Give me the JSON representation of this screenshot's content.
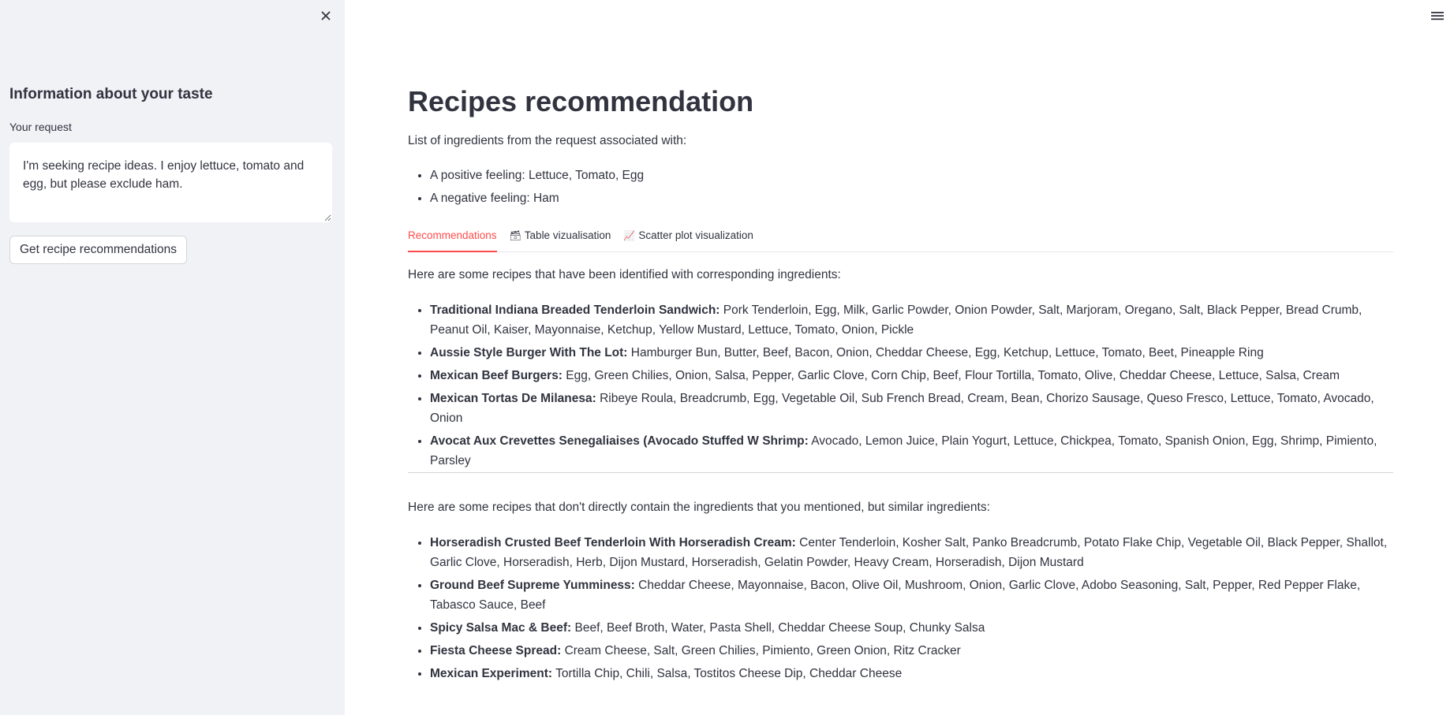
{
  "sidebar": {
    "close_icon": "close-icon",
    "title": "Information about your taste",
    "request_label": "Your request",
    "request_value": "I'm seeking recipe ideas. I enjoy lettuce, tomato and egg, but please exclude ham.",
    "submit_label": "Get recipe recommendations"
  },
  "header": {
    "menu_icon": "hamburger-menu-icon"
  },
  "main": {
    "title": "Recipes recommendation",
    "intro": "List of ingredients from the request associated with:",
    "feelings": [
      "A positive feeling: Lettuce, Tomato, Egg",
      "A negative feeling: Ham"
    ],
    "tabs": [
      {
        "label": "Recommendations",
        "icon": ""
      },
      {
        "label": "Table vizualisation",
        "icon": "🗃"
      },
      {
        "label": "Scatter plot visualization",
        "icon": "📈"
      }
    ],
    "section1_text": "Here are some recipes that have been identified with corresponding ingredients:",
    "recipes1": [
      {
        "name": "Traditional Indiana Breaded Tenderloin Sandwich:",
        "ingredients": "Pork Tenderloin, Egg, Milk, Garlic Powder, Onion Powder, Salt, Marjoram, Oregano, Salt, Black Pepper, Bread Crumb, Peanut Oil, Kaiser, Mayonnaise, Ketchup, Yellow Mustard, Lettuce, Tomato, Onion, Pickle"
      },
      {
        "name": "Aussie Style Burger With The Lot:",
        "ingredients": "Hamburger Bun, Butter, Beef, Bacon, Onion, Cheddar Cheese, Egg, Ketchup, Lettuce, Tomato, Beet, Pineapple Ring"
      },
      {
        "name": "Mexican Beef Burgers:",
        "ingredients": "Egg, Green Chilies, Onion, Salsa, Pepper, Garlic Clove, Corn Chip, Beef, Flour Tortilla, Tomato, Olive, Cheddar Cheese, Lettuce, Salsa, Cream"
      },
      {
        "name": "Mexican Tortas De Milanesa:",
        "ingredients": "Ribeye Roula, Breadcrumb, Egg, Vegetable Oil, Sub French Bread, Cream, Bean, Chorizo Sausage, Queso Fresco, Lettuce, Tomato, Avocado, Onion"
      },
      {
        "name": "Avocat Aux Crevettes Senegaliaises (Avocado Stuffed W Shrimp:",
        "ingredients": "Avocado, Lemon Juice, Plain Yogurt, Lettuce, Chickpea, Tomato, Spanish Onion, Egg, Shrimp, Pimiento, Parsley"
      }
    ],
    "section2_text": "Here are some recipes that don't directly contain the ingredients that you mentioned, but similar ingredients:",
    "recipes2": [
      {
        "name": "Horseradish Crusted Beef Tenderloin With Horseradish Cream:",
        "ingredients": "Center Tenderloin, Kosher Salt, Panko Breadcrumb, Potato Flake Chip, Vegetable Oil, Black Pepper, Shallot, Garlic Clove, Horseradish, Herb, Dijon Mustard, Horseradish, Gelatin Powder, Heavy Cream, Horseradish, Dijon Mustard"
      },
      {
        "name": "Ground Beef Supreme Yumminess:",
        "ingredients": "Cheddar Cheese, Mayonnaise, Bacon, Olive Oil, Mushroom, Onion, Garlic Clove, Adobo Seasoning, Salt, Pepper, Red Pepper Flake, Tabasco Sauce, Beef"
      },
      {
        "name": "Spicy Salsa Mac & Beef:",
        "ingredients": "Beef, Beef Broth, Water, Pasta Shell, Cheddar Cheese Soup, Chunky Salsa"
      },
      {
        "name": "Fiesta Cheese Spread:",
        "ingredients": "Cream Cheese, Salt, Green Chilies, Pimiento, Green Onion, Ritz Cracker"
      },
      {
        "name": "Mexican Experiment:",
        "ingredients": "Tortilla Chip, Chili, Salsa, Tostitos Cheese Dip, Cheddar Cheese"
      }
    ]
  },
  "colors": {
    "sidebar_bg": "#f0f2f6",
    "text": "#31333f",
    "accent": "#ff4b4b"
  }
}
